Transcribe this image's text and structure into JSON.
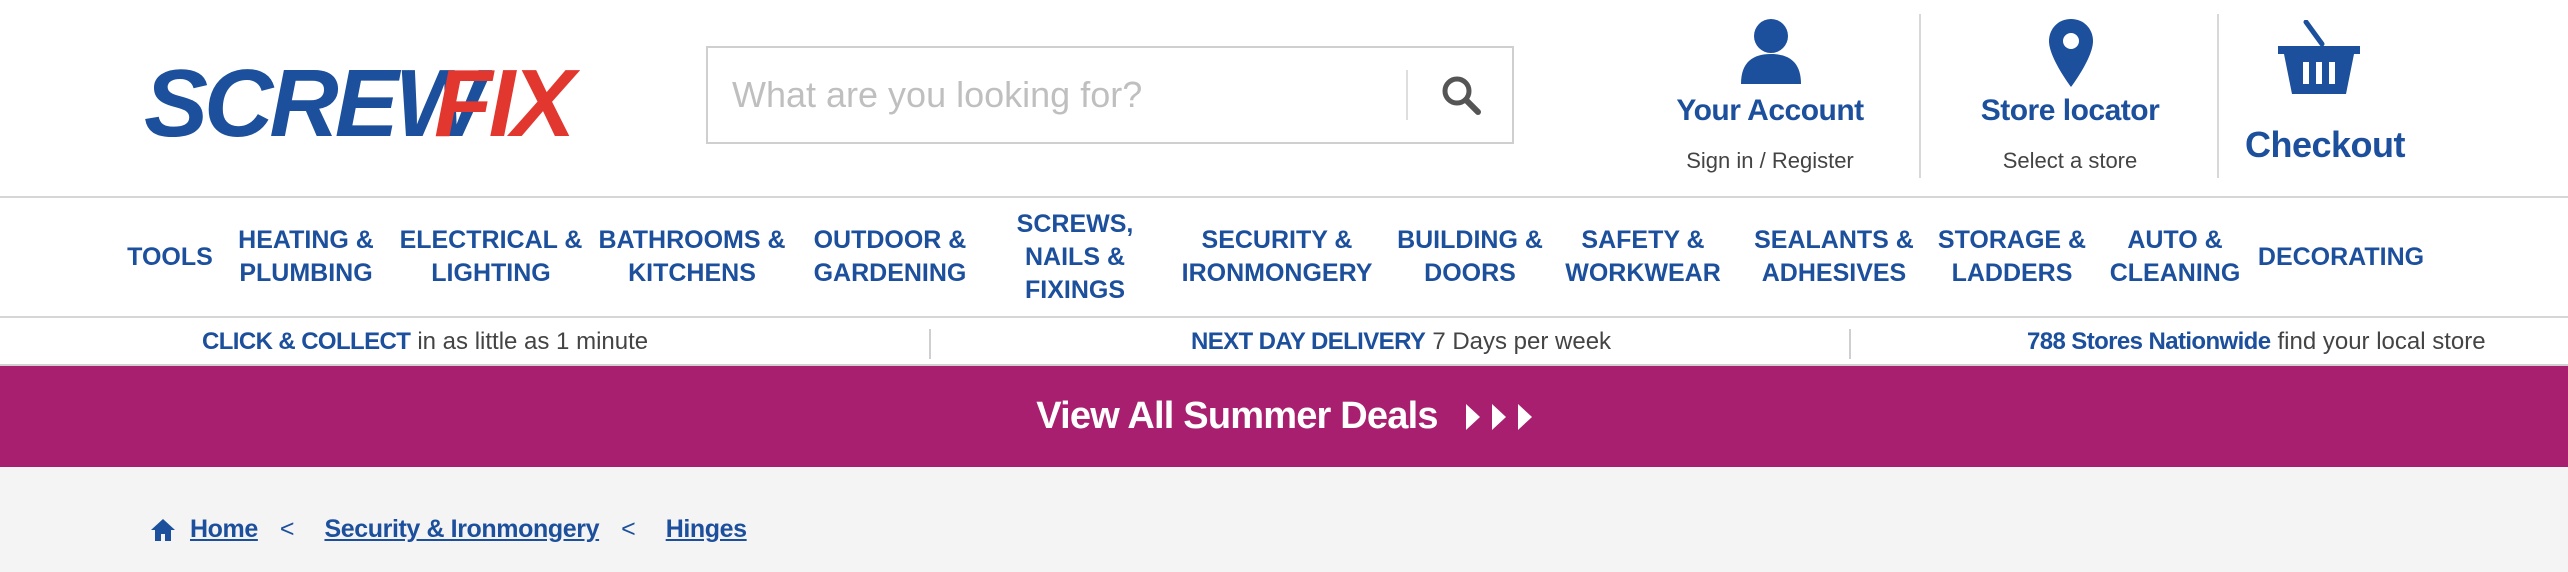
{
  "header": {
    "logo_text_a": "SCREW",
    "logo_text_b": "FIX",
    "search_placeholder": "What are you looking for?",
    "search_icon": "magnifier-icon",
    "account": {
      "title": "Your Account",
      "sub": "Sign in / Register",
      "icon": "user-icon"
    },
    "store": {
      "title": "Store locator",
      "sub": "Select a store",
      "icon": "map-pin-icon"
    },
    "checkout": {
      "title": "Checkout",
      "icon": "basket-icon"
    }
  },
  "nav": {
    "items": [
      "TOOLS",
      "HEATING &\nPLUMBING",
      "ELECTRICAL &\nLIGHTING",
      "BATHROOMS &\nKITCHENS",
      "OUTDOOR &\nGARDENING",
      "SCREWS,\nNAILS &\nFIXINGS",
      "SECURITY &\nIRONMONGERY",
      "BUILDING &\nDOORS",
      "SAFETY &\nWORKWEAR",
      "SEALANTS &\nADHESIVES",
      "STORAGE &\nLADDERS",
      "AUTO &\nCLEANING",
      "DECORATING"
    ]
  },
  "usp": [
    {
      "strong": "CLICK & COLLECT",
      "text": "in as little as 1 minute"
    },
    {
      "strong": "NEXT DAY DELIVERY",
      "text": "7 Days per week"
    },
    {
      "strong": "788 Stores Nationwide",
      "text": "find your local store"
    }
  ],
  "promo": {
    "text": "View All Summer Deals"
  },
  "breadcrumb": {
    "home_icon": "home-icon",
    "items": [
      "Home",
      "Security & Ironmongery",
      "Hinges"
    ],
    "separator": "<"
  },
  "colors": {
    "brand_blue": "#1c4f9c",
    "brand_red": "#e2372f",
    "promo": "#a71f6e"
  }
}
